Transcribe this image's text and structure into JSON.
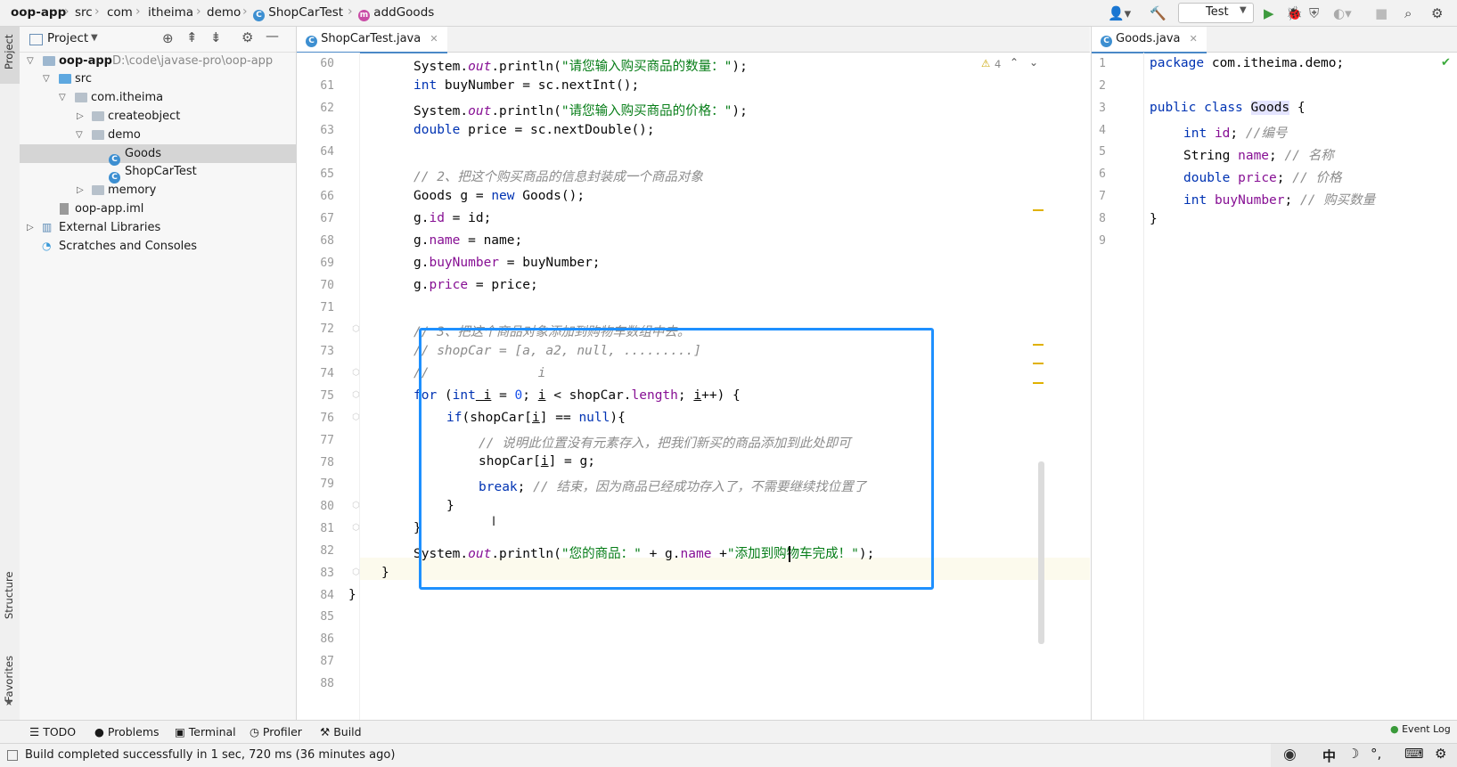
{
  "breadcrumb": [
    "oop-app",
    "src",
    "com",
    "itheima",
    "demo",
    "ShopCarTest",
    "addGoods"
  ],
  "toolbar": {
    "run_config": "Test"
  },
  "sidebar_strip": {
    "project": "Project",
    "structure": "Structure",
    "favorites": "Favorites"
  },
  "project": {
    "title": "Project",
    "tree": [
      {
        "label": "oop-app",
        "hint": "D:\\code\\javase-pro\\oop-app"
      },
      {
        "label": "src"
      },
      {
        "label": "com.itheima"
      },
      {
        "label": "createobject"
      },
      {
        "label": "demo"
      },
      {
        "label": "Goods"
      },
      {
        "label": "ShopCarTest"
      },
      {
        "label": "memory"
      },
      {
        "label": "oop-app.iml"
      },
      {
        "label": "External Libraries"
      },
      {
        "label": "Scratches and Consoles"
      }
    ]
  },
  "editor": {
    "tab": "ShopCarTest.java",
    "warnings": "4",
    "line_numbers": [
      "60",
      "61",
      "62",
      "63",
      "64",
      "65",
      "66",
      "67",
      "68",
      "69",
      "70",
      "71",
      "72",
      "73",
      "74",
      "75",
      "76",
      "77",
      "78",
      "79",
      "80",
      "81",
      "82",
      "83",
      "84",
      "85",
      "86",
      "87",
      "88"
    ]
  },
  "code": {
    "l60": [
      "System.",
      "out",
      ".println(",
      "\"请您输入购买商品的数量：\"",
      ");"
    ],
    "l61": [
      "int",
      " buyNumber = sc.nextInt();"
    ],
    "l62": [
      "System.",
      "out",
      ".println(",
      "\"请您输入购买商品的价格：\"",
      ");"
    ],
    "l63": [
      "double",
      " price = sc.nextDouble();"
    ],
    "l65": "// 2、把这个购买商品的信息封装成一个商品对象",
    "l66": [
      "Goods g = ",
      "new",
      " Goods();"
    ],
    "l67": [
      "g.",
      "id",
      " = id;"
    ],
    "l68": [
      "g.",
      "name",
      " = name;"
    ],
    "l69": [
      "g.",
      "buyNumber",
      " = buyNumber;"
    ],
    "l70": [
      "g.",
      "price",
      " = price;"
    ],
    "l72": "// 3、把这个商品对象添加到购物车数组中去。",
    "l73": "// shopCar = [a, a2, null, .........]",
    "l74": "//              i",
    "l75": [
      "for",
      " (",
      "int",
      " i",
      " = ",
      "0",
      "; ",
      "i",
      " < shopCar.",
      "length",
      "; ",
      "i",
      "++) {"
    ],
    "l76": [
      "if",
      "(shopCar[",
      "i",
      "] == ",
      "null",
      "){"
    ],
    "l77": "// 说明此位置没有元素存入，把我们新买的商品添加到此处即可",
    "l78": [
      "shopCar[",
      "i",
      "] = g;"
    ],
    "l79": [
      "break",
      "; ",
      "// 结束，因为商品已经成功存入了，不需要继续找位置了"
    ],
    "l80": "}",
    "l81": "}",
    "l82": [
      "System.",
      "out",
      ".println(",
      "\"您的商品：\"",
      " + g.",
      "name",
      " +",
      "\"添加到购物车完成！\"",
      ");"
    ],
    "l83": "}",
    "l84": "}"
  },
  "right_editor": {
    "tab": "Goods.java",
    "line_numbers": [
      "1",
      "2",
      "3",
      "4",
      "5",
      "6",
      "7",
      "8",
      "9"
    ],
    "l1": [
      "package",
      " com.itheima.demo;"
    ],
    "l3": [
      "public",
      " ",
      "class",
      " ",
      "Goods",
      " {"
    ],
    "l4": [
      "int",
      " ",
      "id",
      "; ",
      "//编号"
    ],
    "l5": [
      "String ",
      "name",
      "; ",
      "// 名称"
    ],
    "l6": [
      "double",
      " ",
      "price",
      "; ",
      "// 价格"
    ],
    "l7": [
      "int",
      " ",
      "buyNumber",
      "; ",
      "// 购买数量"
    ],
    "l8": "}"
  },
  "tool_windows": [
    "TODO",
    "Problems",
    "Terminal",
    "Profiler",
    "Build",
    "Event Log"
  ],
  "status": {
    "message": "Build completed successfully in 1 sec, 720 ms (36 minutes ago)"
  },
  "ime": {
    "char": "中"
  }
}
